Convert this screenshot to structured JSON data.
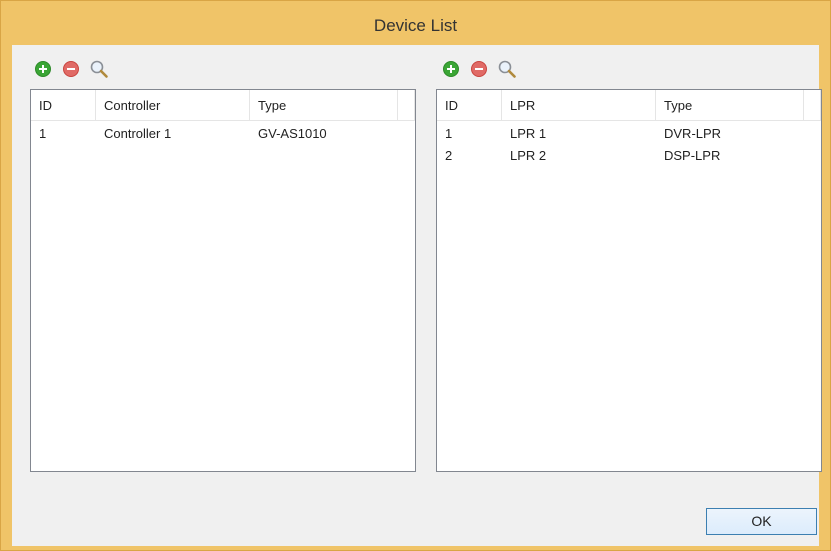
{
  "window": {
    "title": "Device List"
  },
  "left_panel": {
    "columns": [
      "ID",
      "Controller",
      "Type"
    ],
    "rows": [
      [
        "1",
        "Controller 1",
        "GV-AS1010"
      ]
    ]
  },
  "right_panel": {
    "columns": [
      "ID",
      "LPR",
      "Type"
    ],
    "rows": [
      [
        "1",
        "LPR 1",
        "DVR-LPR"
      ],
      [
        "2",
        "LPR 2",
        "DSP-LPR"
      ]
    ]
  },
  "icons": {
    "add": "add-icon",
    "remove": "remove-icon",
    "search": "search-icon"
  },
  "colors": {
    "title_bar": "#f0c468",
    "add_green": "#3aa535",
    "remove_red": "#d9534f",
    "ok_border": "#3c7fb1"
  },
  "footer": {
    "ok_label": "OK"
  }
}
